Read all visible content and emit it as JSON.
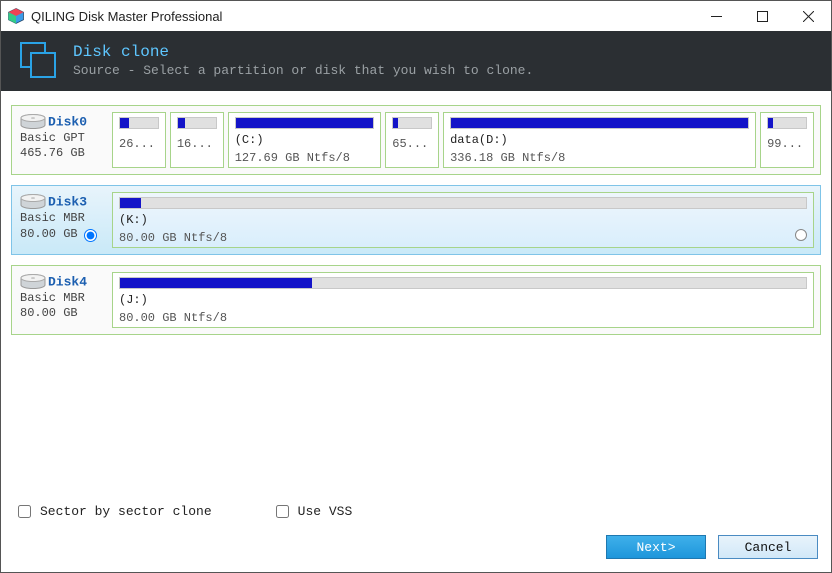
{
  "window": {
    "title": "QILING Disk Master Professional"
  },
  "header": {
    "title": "Disk clone",
    "subtitle": "Source - Select a partition or disk that you wish to clone."
  },
  "disks": [
    {
      "name": "Disk0",
      "scheme": "Basic GPT",
      "size": "465.76 GB",
      "selected": false,
      "green": true,
      "partitions": [
        {
          "label1": "",
          "label2": "26...",
          "fillPct": 24,
          "flex": 4
        },
        {
          "label1": "",
          "label2": "16...",
          "fillPct": 18,
          "flex": 4
        },
        {
          "label1": "(C:)",
          "label2": "127.69 GB Ntfs/8",
          "fillPct": 100,
          "flex": 14
        },
        {
          "label1": "",
          "label2": "65...",
          "fillPct": 12,
          "flex": 4
        },
        {
          "label1": "data(D:)",
          "label2": "336.18 GB Ntfs/8",
          "fillPct": 100,
          "flex": 30
        },
        {
          "label1": "",
          "label2": "99...",
          "fillPct": 12,
          "flex": 4
        }
      ]
    },
    {
      "name": "Disk3",
      "scheme": "Basic MBR",
      "size": "80.00 GB",
      "selected": true,
      "green": false,
      "radioChecked": true,
      "partitions": [
        {
          "label1": "(K:)",
          "label2": "80.00 GB Ntfs/8",
          "fillPct": 3,
          "flex": 1,
          "showSelRadio": true
        }
      ]
    },
    {
      "name": "Disk4",
      "scheme": "Basic MBR",
      "size": "80.00 GB",
      "selected": false,
      "green": true,
      "partitions": [
        {
          "label1": "(J:)",
          "label2": "80.00 GB Ntfs/8",
          "fillPct": 28,
          "flex": 1
        }
      ]
    }
  ],
  "options": {
    "sectorBySector": {
      "label": "Sector by sector clone",
      "checked": false
    },
    "useVSS": {
      "label": "Use VSS",
      "checked": false
    }
  },
  "buttons": {
    "next": "Next>",
    "cancel": "Cancel"
  }
}
